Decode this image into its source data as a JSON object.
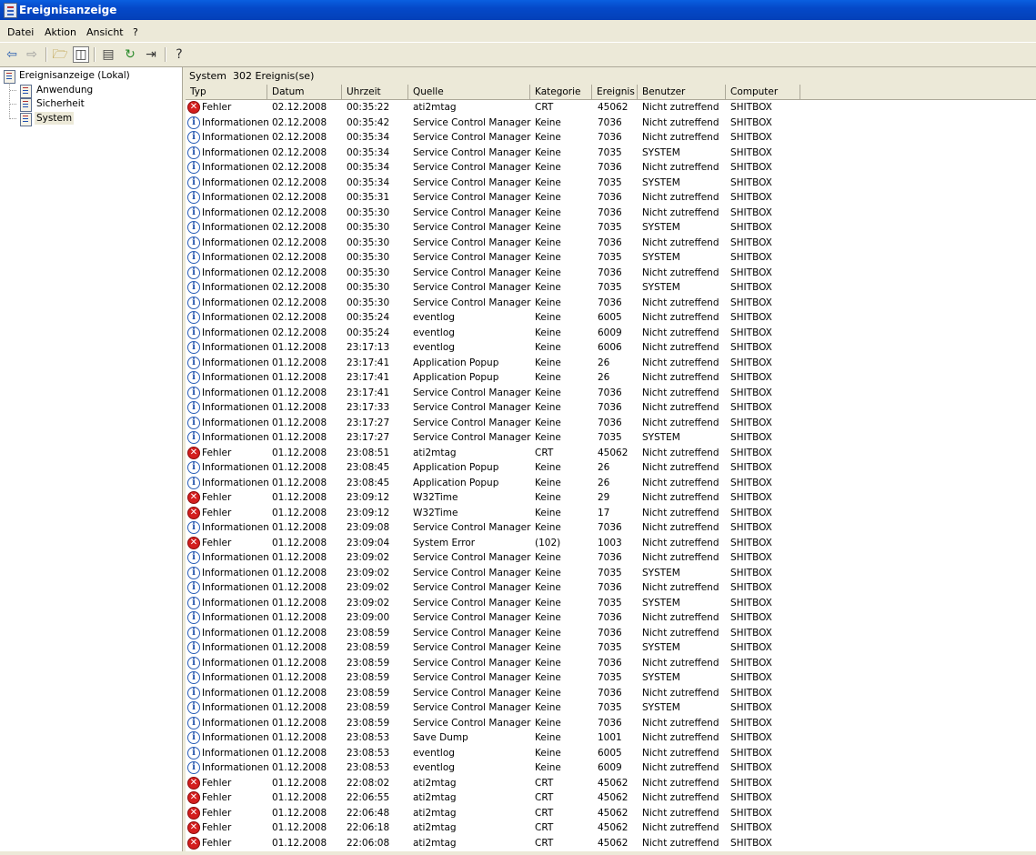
{
  "window": {
    "title": "Ereignisanzeige"
  },
  "menu": [
    "Datei",
    "Aktion",
    "Ansicht",
    "?"
  ],
  "toolbar_icons": [
    "back-arrow-icon",
    "forward-arrow-icon",
    "up-folder-icon",
    "show-hide-tree-icon",
    "properties-icon",
    "refresh-icon",
    "export-list-icon",
    "help-icon"
  ],
  "tree": {
    "root": "Ereignisanzeige (Lokal)",
    "children": [
      "Anwendung",
      "Sicherheit",
      "System"
    ],
    "selected": "System"
  },
  "panel": {
    "name": "System",
    "count": "302 Ereignis(se)"
  },
  "columns": [
    "Typ",
    "Datum",
    "Uhrzeit",
    "Quelle",
    "Kategorie",
    "Ereignis",
    "Benutzer",
    "Computer"
  ],
  "type_labels": {
    "info": "Informationen",
    "error": "Fehler"
  },
  "events": [
    [
      "error",
      "02.12.2008",
      "00:35:22",
      "ati2mtag",
      "CRT",
      "45062",
      "Nicht zutreffend",
      "SHITBOX"
    ],
    [
      "info",
      "02.12.2008",
      "00:35:42",
      "Service Control Manager",
      "Keine",
      "7036",
      "Nicht zutreffend",
      "SHITBOX"
    ],
    [
      "info",
      "02.12.2008",
      "00:35:34",
      "Service Control Manager",
      "Keine",
      "7036",
      "Nicht zutreffend",
      "SHITBOX"
    ],
    [
      "info",
      "02.12.2008",
      "00:35:34",
      "Service Control Manager",
      "Keine",
      "7035",
      "SYSTEM",
      "SHITBOX"
    ],
    [
      "info",
      "02.12.2008",
      "00:35:34",
      "Service Control Manager",
      "Keine",
      "7036",
      "Nicht zutreffend",
      "SHITBOX"
    ],
    [
      "info",
      "02.12.2008",
      "00:35:34",
      "Service Control Manager",
      "Keine",
      "7035",
      "SYSTEM",
      "SHITBOX"
    ],
    [
      "info",
      "02.12.2008",
      "00:35:31",
      "Service Control Manager",
      "Keine",
      "7036",
      "Nicht zutreffend",
      "SHITBOX"
    ],
    [
      "info",
      "02.12.2008",
      "00:35:30",
      "Service Control Manager",
      "Keine",
      "7036",
      "Nicht zutreffend",
      "SHITBOX"
    ],
    [
      "info",
      "02.12.2008",
      "00:35:30",
      "Service Control Manager",
      "Keine",
      "7035",
      "SYSTEM",
      "SHITBOX"
    ],
    [
      "info",
      "02.12.2008",
      "00:35:30",
      "Service Control Manager",
      "Keine",
      "7036",
      "Nicht zutreffend",
      "SHITBOX"
    ],
    [
      "info",
      "02.12.2008",
      "00:35:30",
      "Service Control Manager",
      "Keine",
      "7035",
      "SYSTEM",
      "SHITBOX"
    ],
    [
      "info",
      "02.12.2008",
      "00:35:30",
      "Service Control Manager",
      "Keine",
      "7036",
      "Nicht zutreffend",
      "SHITBOX"
    ],
    [
      "info",
      "02.12.2008",
      "00:35:30",
      "Service Control Manager",
      "Keine",
      "7035",
      "SYSTEM",
      "SHITBOX"
    ],
    [
      "info",
      "02.12.2008",
      "00:35:30",
      "Service Control Manager",
      "Keine",
      "7036",
      "Nicht zutreffend",
      "SHITBOX"
    ],
    [
      "info",
      "02.12.2008",
      "00:35:24",
      "eventlog",
      "Keine",
      "6005",
      "Nicht zutreffend",
      "SHITBOX"
    ],
    [
      "info",
      "02.12.2008",
      "00:35:24",
      "eventlog",
      "Keine",
      "6009",
      "Nicht zutreffend",
      "SHITBOX"
    ],
    [
      "info",
      "01.12.2008",
      "23:17:13",
      "eventlog",
      "Keine",
      "6006",
      "Nicht zutreffend",
      "SHITBOX"
    ],
    [
      "info",
      "01.12.2008",
      "23:17:41",
      "Application Popup",
      "Keine",
      "26",
      "Nicht zutreffend",
      "SHITBOX"
    ],
    [
      "info",
      "01.12.2008",
      "23:17:41",
      "Application Popup",
      "Keine",
      "26",
      "Nicht zutreffend",
      "SHITBOX"
    ],
    [
      "info",
      "01.12.2008",
      "23:17:41",
      "Service Control Manager",
      "Keine",
      "7036",
      "Nicht zutreffend",
      "SHITBOX"
    ],
    [
      "info",
      "01.12.2008",
      "23:17:33",
      "Service Control Manager",
      "Keine",
      "7036",
      "Nicht zutreffend",
      "SHITBOX"
    ],
    [
      "info",
      "01.12.2008",
      "23:17:27",
      "Service Control Manager",
      "Keine",
      "7036",
      "Nicht zutreffend",
      "SHITBOX"
    ],
    [
      "info",
      "01.12.2008",
      "23:17:27",
      "Service Control Manager",
      "Keine",
      "7035",
      "SYSTEM",
      "SHITBOX"
    ],
    [
      "error",
      "01.12.2008",
      "23:08:51",
      "ati2mtag",
      "CRT",
      "45062",
      "Nicht zutreffend",
      "SHITBOX"
    ],
    [
      "info",
      "01.12.2008",
      "23:08:45",
      "Application Popup",
      "Keine",
      "26",
      "Nicht zutreffend",
      "SHITBOX"
    ],
    [
      "info",
      "01.12.2008",
      "23:08:45",
      "Application Popup",
      "Keine",
      "26",
      "Nicht zutreffend",
      "SHITBOX"
    ],
    [
      "error",
      "01.12.2008",
      "23:09:12",
      "W32Time",
      "Keine",
      "29",
      "Nicht zutreffend",
      "SHITBOX"
    ],
    [
      "error",
      "01.12.2008",
      "23:09:12",
      "W32Time",
      "Keine",
      "17",
      "Nicht zutreffend",
      "SHITBOX"
    ],
    [
      "info",
      "01.12.2008",
      "23:09:08",
      "Service Control Manager",
      "Keine",
      "7036",
      "Nicht zutreffend",
      "SHITBOX"
    ],
    [
      "error",
      "01.12.2008",
      "23:09:04",
      "System Error",
      "(102)",
      "1003",
      "Nicht zutreffend",
      "SHITBOX"
    ],
    [
      "info",
      "01.12.2008",
      "23:09:02",
      "Service Control Manager",
      "Keine",
      "7036",
      "Nicht zutreffend",
      "SHITBOX"
    ],
    [
      "info",
      "01.12.2008",
      "23:09:02",
      "Service Control Manager",
      "Keine",
      "7035",
      "SYSTEM",
      "SHITBOX"
    ],
    [
      "info",
      "01.12.2008",
      "23:09:02",
      "Service Control Manager",
      "Keine",
      "7036",
      "Nicht zutreffend",
      "SHITBOX"
    ],
    [
      "info",
      "01.12.2008",
      "23:09:02",
      "Service Control Manager",
      "Keine",
      "7035",
      "SYSTEM",
      "SHITBOX"
    ],
    [
      "info",
      "01.12.2008",
      "23:09:00",
      "Service Control Manager",
      "Keine",
      "7036",
      "Nicht zutreffend",
      "SHITBOX"
    ],
    [
      "info",
      "01.12.2008",
      "23:08:59",
      "Service Control Manager",
      "Keine",
      "7036",
      "Nicht zutreffend",
      "SHITBOX"
    ],
    [
      "info",
      "01.12.2008",
      "23:08:59",
      "Service Control Manager",
      "Keine",
      "7035",
      "SYSTEM",
      "SHITBOX"
    ],
    [
      "info",
      "01.12.2008",
      "23:08:59",
      "Service Control Manager",
      "Keine",
      "7036",
      "Nicht zutreffend",
      "SHITBOX"
    ],
    [
      "info",
      "01.12.2008",
      "23:08:59",
      "Service Control Manager",
      "Keine",
      "7035",
      "SYSTEM",
      "SHITBOX"
    ],
    [
      "info",
      "01.12.2008",
      "23:08:59",
      "Service Control Manager",
      "Keine",
      "7036",
      "Nicht zutreffend",
      "SHITBOX"
    ],
    [
      "info",
      "01.12.2008",
      "23:08:59",
      "Service Control Manager",
      "Keine",
      "7035",
      "SYSTEM",
      "SHITBOX"
    ],
    [
      "info",
      "01.12.2008",
      "23:08:59",
      "Service Control Manager",
      "Keine",
      "7036",
      "Nicht zutreffend",
      "SHITBOX"
    ],
    [
      "info",
      "01.12.2008",
      "23:08:53",
      "Save Dump",
      "Keine",
      "1001",
      "Nicht zutreffend",
      "SHITBOX"
    ],
    [
      "info",
      "01.12.2008",
      "23:08:53",
      "eventlog",
      "Keine",
      "6005",
      "Nicht zutreffend",
      "SHITBOX"
    ],
    [
      "info",
      "01.12.2008",
      "23:08:53",
      "eventlog",
      "Keine",
      "6009",
      "Nicht zutreffend",
      "SHITBOX"
    ],
    [
      "error",
      "01.12.2008",
      "22:08:02",
      "ati2mtag",
      "CRT",
      "45062",
      "Nicht zutreffend",
      "SHITBOX"
    ],
    [
      "error",
      "01.12.2008",
      "22:06:55",
      "ati2mtag",
      "CRT",
      "45062",
      "Nicht zutreffend",
      "SHITBOX"
    ],
    [
      "error",
      "01.12.2008",
      "22:06:48",
      "ati2mtag",
      "CRT",
      "45062",
      "Nicht zutreffend",
      "SHITBOX"
    ],
    [
      "error",
      "01.12.2008",
      "22:06:18",
      "ati2mtag",
      "CRT",
      "45062",
      "Nicht zutreffend",
      "SHITBOX"
    ],
    [
      "error",
      "01.12.2008",
      "22:06:08",
      "ati2mtag",
      "CRT",
      "45062",
      "Nicht zutreffend",
      "SHITBOX"
    ]
  ]
}
